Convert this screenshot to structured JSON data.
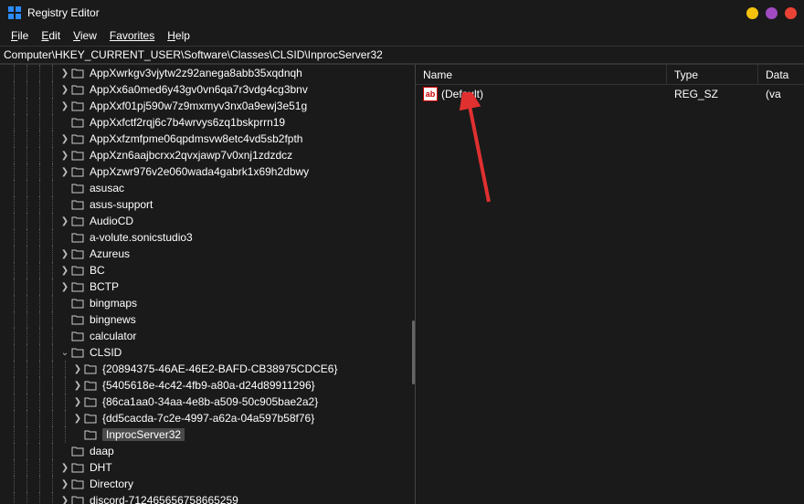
{
  "window": {
    "title": "Registry Editor",
    "controls_colors": {
      "min": "#f4c20d",
      "max": "#a24ac1",
      "close": "#ea4335"
    }
  },
  "menubar": {
    "file": "File",
    "edit": "Edit",
    "view": "View",
    "favorites": "Favorites",
    "help": "Help"
  },
  "address": "Computer\\HKEY_CURRENT_USER\\Software\\Classes\\CLSID\\InprocServer32",
  "tree": {
    "items": [
      {
        "depth": 4,
        "chev": ">",
        "label": "AppXwrkgv3vjytw2z92anega8abb35xqdnqh"
      },
      {
        "depth": 4,
        "chev": ">",
        "label": "AppXx6a0med6y43gv0vn6qa7r3vdg4cg3bnv"
      },
      {
        "depth": 4,
        "chev": ">",
        "label": "AppXxf01pj590w7z9mxmyv3nx0a9ewj3e51g"
      },
      {
        "depth": 4,
        "chev": "",
        "label": "AppXxfctf2rqj6c7b4wrvys6zq1bskprrn19"
      },
      {
        "depth": 4,
        "chev": ">",
        "label": "AppXxfzmfpme06qpdmsvw8etc4vd5sb2fpth"
      },
      {
        "depth": 4,
        "chev": ">",
        "label": "AppXzn6aajbcrxx2qvxjawp7v0xnj1zdzdcz"
      },
      {
        "depth": 4,
        "chev": ">",
        "label": "AppXzwr976v2e060wada4gabrk1x69h2dbwy"
      },
      {
        "depth": 4,
        "chev": "",
        "label": "asusac"
      },
      {
        "depth": 4,
        "chev": "",
        "label": "asus-support"
      },
      {
        "depth": 4,
        "chev": ">",
        "label": "AudioCD"
      },
      {
        "depth": 4,
        "chev": "",
        "label": "a-volute.sonicstudio3"
      },
      {
        "depth": 4,
        "chev": ">",
        "label": "Azureus"
      },
      {
        "depth": 4,
        "chev": ">",
        "label": "BC"
      },
      {
        "depth": 4,
        "chev": ">",
        "label": "BCTP"
      },
      {
        "depth": 4,
        "chev": "",
        "label": "bingmaps"
      },
      {
        "depth": 4,
        "chev": "",
        "label": "bingnews"
      },
      {
        "depth": 4,
        "chev": "",
        "label": "calculator"
      },
      {
        "depth": 4,
        "chev": "v",
        "label": "CLSID"
      },
      {
        "depth": 5,
        "chev": ">",
        "label": "{20894375-46AE-46E2-BAFD-CB38975CDCE6}"
      },
      {
        "depth": 5,
        "chev": ">",
        "label": "{5405618e-4c42-4fb9-a80a-d24d89911296}"
      },
      {
        "depth": 5,
        "chev": ">",
        "label": "{86ca1aa0-34aa-4e8b-a509-50c905bae2a2}"
      },
      {
        "depth": 5,
        "chev": ">",
        "label": "{dd5cacda-7c2e-4997-a62a-04a597b58f76}"
      },
      {
        "depth": 5,
        "chev": "",
        "label": "InprocServer32",
        "selected": true
      },
      {
        "depth": 4,
        "chev": "",
        "label": "daap"
      },
      {
        "depth": 4,
        "chev": ">",
        "label": "DHT"
      },
      {
        "depth": 4,
        "chev": ">",
        "label": "Directory"
      },
      {
        "depth": 4,
        "chev": ">",
        "label": "discord-712465656758665259"
      }
    ]
  },
  "list": {
    "columns": {
      "name": "Name",
      "type": "Type",
      "data": "Data"
    },
    "rows": [
      {
        "icon": "ab",
        "name": "(Default)",
        "type": "REG_SZ",
        "data": "(va"
      }
    ]
  }
}
